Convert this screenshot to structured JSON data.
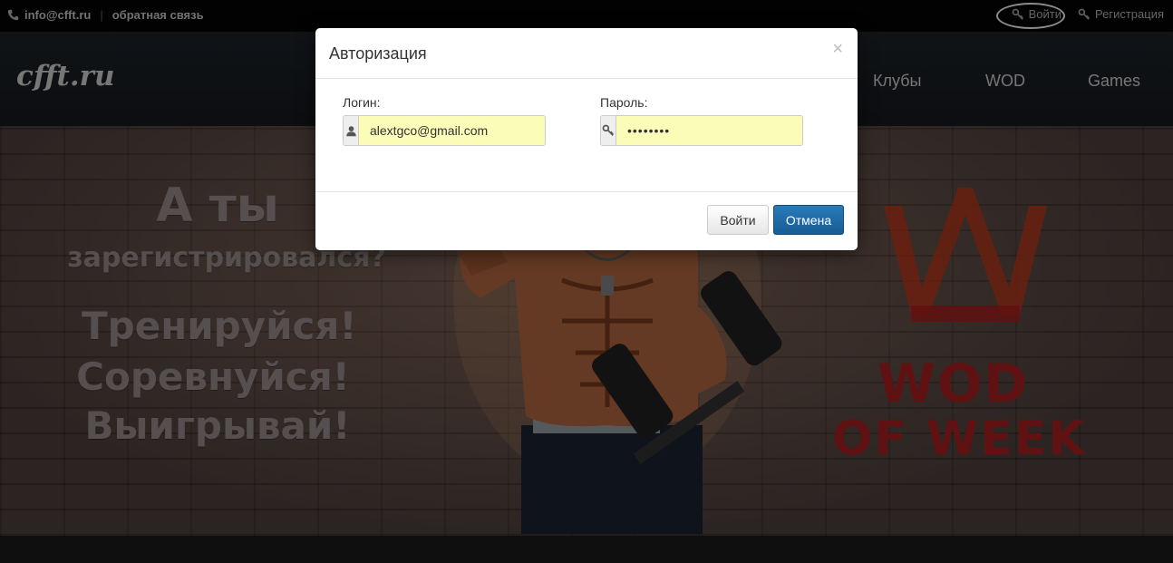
{
  "topbar": {
    "email": "info@cfft.ru",
    "separator": "|",
    "feedback": "обратная связь",
    "login": "Войти",
    "register": "Регистрация"
  },
  "navbar": {
    "logo": "cfft.ru",
    "items": [
      "Клубы",
      "WOD",
      "Games"
    ]
  },
  "hero": {
    "slogan_line1": "А ты",
    "slogan_line2": "зарегистрировался?",
    "slogan_line3": "Тренируйся!",
    "slogan_line4": "Соревнуйся!",
    "slogan_line5": "Выигрывай!",
    "wod_line1": "WOD",
    "wod_line2": "OF WEEK"
  },
  "modal": {
    "title": "Авторизация",
    "close": "×",
    "login_label": "Логин:",
    "login_value": "alextgco@gmail.com",
    "password_label": "Пароль:",
    "password_value": "••••••••",
    "submit": "Войти",
    "cancel": "Отмена"
  },
  "colors": {
    "primary_button": "#175d95",
    "autofill": "#fafcb8",
    "wod_red": "#b0201f"
  }
}
